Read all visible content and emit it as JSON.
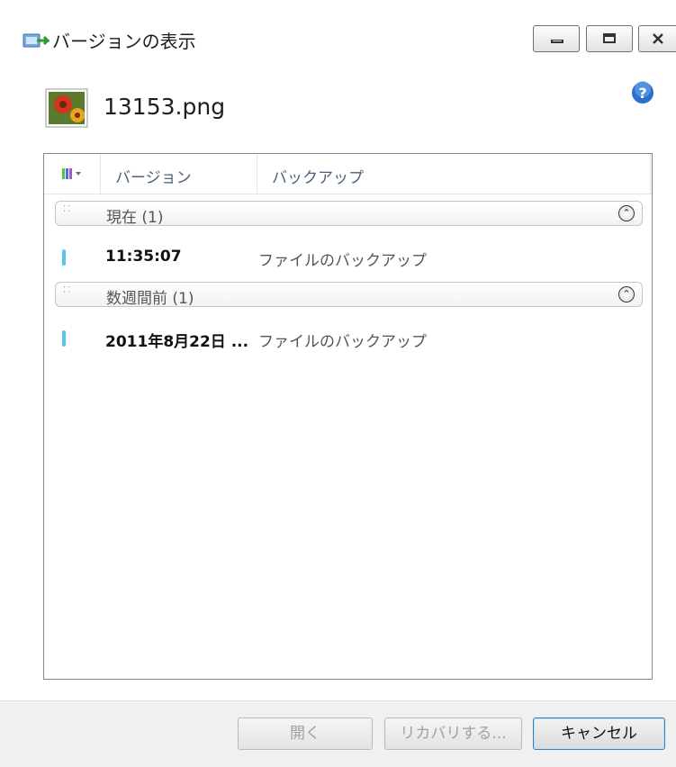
{
  "window": {
    "title": "バージョンの表示"
  },
  "file": {
    "name": "13153.png"
  },
  "list": {
    "columns": [
      "バージョン",
      "バックアップ"
    ],
    "groups": [
      {
        "label": "現在 (1)",
        "items": [
          {
            "time": "11:35:07",
            "type": "ファイルのバックアップ"
          }
        ]
      },
      {
        "label": "数週間前 (1)",
        "items": [
          {
            "time": "2011年8月22日 ...",
            "type": "ファイルのバックアップ"
          }
        ]
      }
    ]
  },
  "buttons": {
    "open": "開く",
    "recover": "リカバリする...",
    "cancel": "キャンセル"
  },
  "colors": {
    "accent": "#3c7fb1",
    "item_marker": "#58c5ea",
    "help": "#2a6fc9"
  }
}
